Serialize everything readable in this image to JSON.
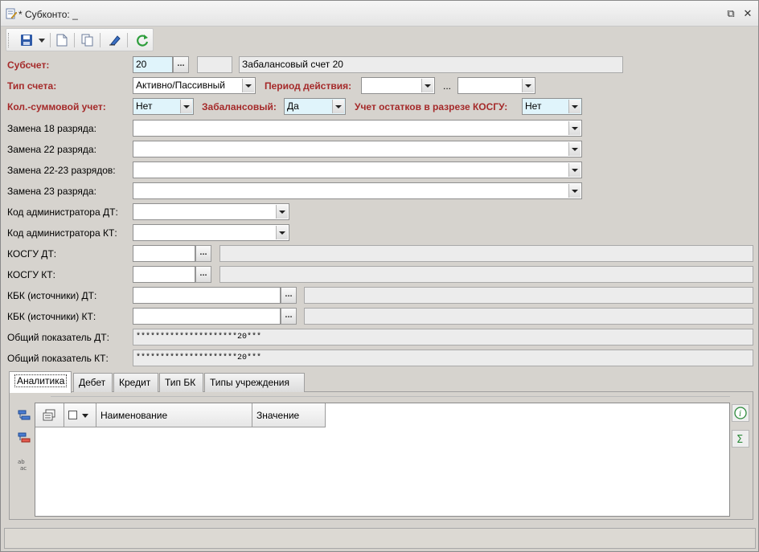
{
  "window": {
    "title": "* Субконто: _",
    "restore_glyph": "⧉",
    "close_glyph": "✕"
  },
  "toolbar": {
    "buttons": [
      "save-icon",
      "dropdown-icon",
      "new-document-icon",
      "copy-icon",
      "clear-icon",
      "refresh-icon"
    ]
  },
  "form": {
    "subaccount": {
      "label": "Субсчет:",
      "value": "20",
      "code": "",
      "name": "Забалансовый счет 20",
      "ellipsis": "..."
    },
    "account_type": {
      "label": "Тип счета:",
      "value": "Активно/Пассивный"
    },
    "period": {
      "label": "Период действия:",
      "from": "",
      "sep": "...",
      "to": ""
    },
    "qty_sum": {
      "label": "Кол.-суммовой учет:",
      "value": "Нет"
    },
    "off_balance": {
      "label": "Забалансовый:",
      "value": "Да"
    },
    "kosgu_balance": {
      "label": "Учет остатков в разрезе КОСГУ:",
      "value": "Нет"
    },
    "replace18": {
      "label": "Замена 18 разряда:",
      "value": ""
    },
    "replace22": {
      "label": "Замена 22 разряда:",
      "value": ""
    },
    "replace2223": {
      "label": "Замена 22-23 разрядов:",
      "value": ""
    },
    "replace23": {
      "label": "Замена 23 разряда:",
      "value": ""
    },
    "admin_dt": {
      "label": "Код администратора ДТ:",
      "value": ""
    },
    "admin_kt": {
      "label": "Код администратора КТ:",
      "value": ""
    },
    "kosgu_dt": {
      "label": "КОСГУ ДТ:",
      "value": "",
      "name": "",
      "ellipsis": "..."
    },
    "kosgu_kt": {
      "label": "КОСГУ КТ:",
      "value": "",
      "name": "",
      "ellipsis": "..."
    },
    "kbk_dt": {
      "label": "КБК (источники) ДТ:",
      "value": "",
      "name": "",
      "ellipsis": "..."
    },
    "kbk_kt": {
      "label": "КБК (источники) КТ:",
      "value": "",
      "name": "",
      "ellipsis": "..."
    },
    "total_dt": {
      "label": "Общий показатель ДТ:",
      "value": "*********************20***"
    },
    "total_kt": {
      "label": "Общий показатель КТ:",
      "value": "*********************20***"
    }
  },
  "tabs": [
    {
      "label": "Аналитика",
      "active": true
    },
    {
      "label": "Дебет",
      "active": false
    },
    {
      "label": "Кредит",
      "active": false
    },
    {
      "label": "Тип БК",
      "active": false
    },
    {
      "label": "Типы учреждения",
      "active": false
    }
  ],
  "grid": {
    "columns": [
      "Наименование",
      "Значение"
    ]
  },
  "side_buttons": [
    "add-row-icon",
    "delete-row-icon",
    "rename-icon"
  ],
  "right_buttons": [
    "info-icon",
    "sum-icon"
  ],
  "colors": {
    "required_label": "#a52a2a",
    "highlight_field": "#e0f4fb"
  }
}
